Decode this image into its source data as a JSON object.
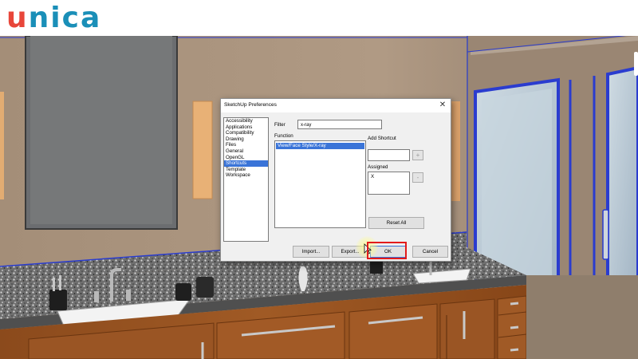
{
  "brand": {
    "logo_text": "unica",
    "logo_accent_letter": "u",
    "logo_rest": "nica",
    "accent_color": "#e8463a",
    "brand_color": "#1a8fb8"
  },
  "dialog": {
    "title": "SketchUp Preferences",
    "close_icon": "close-icon",
    "categories": [
      {
        "label": "Accessibility",
        "selected": false
      },
      {
        "label": "Applications",
        "selected": false
      },
      {
        "label": "Compatibility",
        "selected": false
      },
      {
        "label": "Drawing",
        "selected": false
      },
      {
        "label": "Files",
        "selected": false
      },
      {
        "label": "General",
        "selected": false
      },
      {
        "label": "OpenGL",
        "selected": false
      },
      {
        "label": "Shortcuts",
        "selected": true
      },
      {
        "label": "Template",
        "selected": false
      },
      {
        "label": "Workspace",
        "selected": false
      }
    ],
    "filter_label": "Filter",
    "filter_value": "x-ray",
    "function_label": "Function",
    "functions": [
      {
        "label": "View/Face Style/X-ray",
        "selected": true
      }
    ],
    "add_shortcut_label": "Add Shortcut",
    "add_shortcut_value": "",
    "add_button": "+",
    "assigned_label": "Assigned",
    "assigned_value": "X",
    "remove_button": "-",
    "reset_all": "Reset All",
    "import_button": "Import...",
    "export_button": "Export...",
    "ok_button": "OK",
    "cancel_button": "Cancel",
    "selection_color": "#3a74d8",
    "highlight_color": "#e21b1b"
  }
}
